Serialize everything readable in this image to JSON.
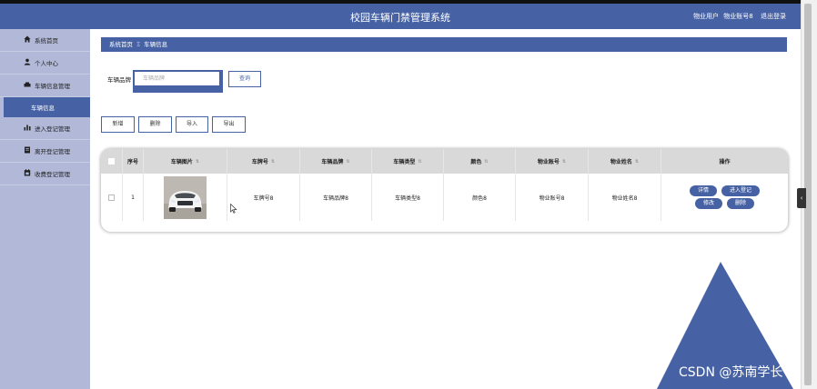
{
  "header": {
    "title": "校园车辆门禁管理系统",
    "user_role": "物业用户",
    "user_account": "物业账号8",
    "logout": "退出登录"
  },
  "sidebar": {
    "items": [
      {
        "label": "系统首页",
        "icon": "home-icon"
      },
      {
        "label": "个人中心",
        "icon": "user-icon"
      },
      {
        "label": "车辆信息管理",
        "icon": "car-icon"
      },
      {
        "label": "车辆信息",
        "icon": "",
        "sub": true
      },
      {
        "label": "进入登记管理",
        "icon": "bar-chart-icon"
      },
      {
        "label": "离开登记管理",
        "icon": "document-icon"
      },
      {
        "label": "收费登记管理",
        "icon": "calendar-icon"
      }
    ]
  },
  "breadcrumb": {
    "home": "系统首页",
    "separator": "Ξ",
    "current": "车辆信息"
  },
  "search": {
    "label": "车辆品牌",
    "placeholder": "车辆品牌",
    "button": "查询"
  },
  "toolbar": {
    "add": "新增",
    "delete": "删除",
    "import": "导入",
    "export": "导出"
  },
  "table": {
    "columns": [
      "序号",
      "车辆图片",
      "车牌号",
      "车辆品牌",
      "车辆类型",
      "颜色",
      "物业账号",
      "物业姓名",
      "操作"
    ],
    "rows": [
      {
        "index": "1",
        "plate": "车牌号8",
        "brand": "车辆品牌8",
        "type": "车辆类型8",
        "color": "颜色8",
        "account": "物业账号8",
        "name": "物业姓名8"
      }
    ],
    "actions": {
      "detail": "详情",
      "enter": "进入登记",
      "edit": "修改",
      "delete": "删除"
    }
  },
  "watermark": "CSDN @苏南学长",
  "colors": {
    "primary": "#4662a5",
    "sidebar": "#b1b8d8",
    "table_header": "#d9d9d9"
  }
}
